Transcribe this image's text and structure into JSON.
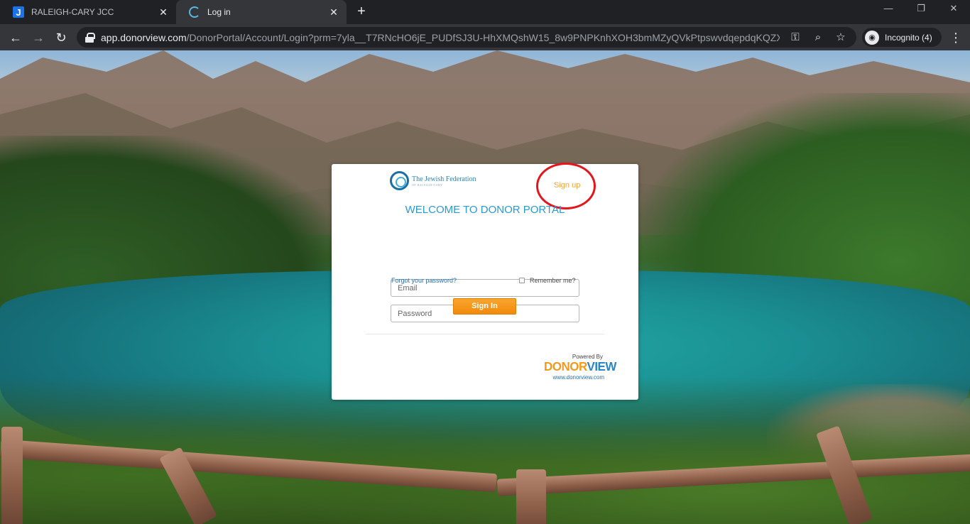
{
  "browser": {
    "tabs": [
      {
        "title": "RALEIGH-CARY JCC",
        "favicon": "jcc-j-icon",
        "active": false
      },
      {
        "title": "Log in",
        "favicon": "loading-spinner-icon",
        "active": true
      }
    ],
    "url_host": "app.donorview.com",
    "url_path": "/DonorPortal/Account/Login?prm=7yla__T7RNcHO6jE_PUDfSJ3U-HhXMQshW15_8w9PNPKnhXOH3bmMZyQVkPtpswvdqepdqKQZXW...",
    "profile_label": "Incognito (4)"
  },
  "card": {
    "logo_name": "The Jewish Federation",
    "logo_sub": "OF RALEIGH-CARY",
    "signup_label": "Sign up",
    "welcome": "WELCOME TO DONOR PORTAL",
    "email_placeholder": "Email",
    "password_placeholder": "Password",
    "forgot_label": "Forgot your password?",
    "remember_label": "Remember me?",
    "signin_label": "Sign In",
    "powered_by": "Powered By",
    "brand_a": "DONOR",
    "brand_b": "VIEW",
    "site": "www.donorview.com"
  },
  "colors": {
    "accent_orange": "#f28a0c",
    "welcome_blue": "#2a9bd1",
    "annotation_red": "#e3161b"
  }
}
